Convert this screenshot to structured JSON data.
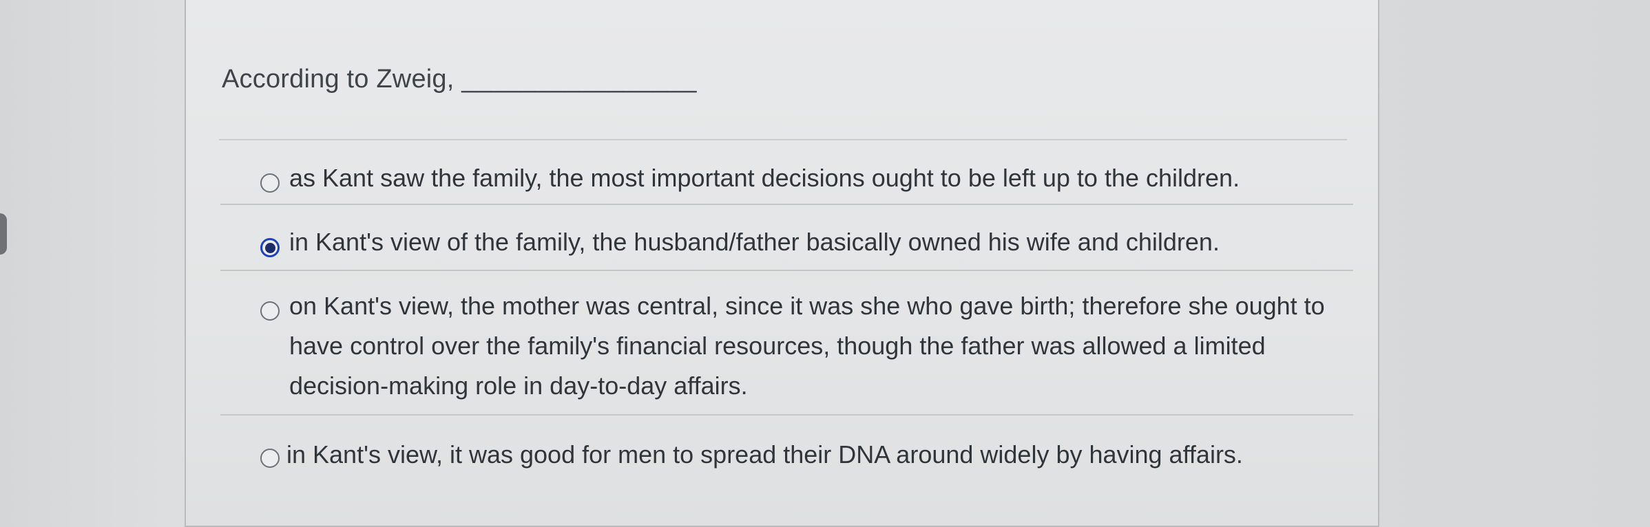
{
  "question": {
    "prompt": "According to Zweig, ________________"
  },
  "options": [
    {
      "text": "as Kant saw the family, the most important decisions ought to be left up to the children.",
      "selected": false
    },
    {
      "text": "in Kant's view of the family, the husband/father basically owned his wife and children.",
      "selected": true
    },
    {
      "text": "on Kant's view, the mother was central, since it was she who gave birth; therefore she ought to have control over the family's financial resources, though the father was allowed a limited decision-making role in day-to-day affairs.",
      "selected": false
    },
    {
      "text": "in Kant's view, it was good for men to spread their DNA around widely by having affairs.",
      "selected": false
    }
  ],
  "colors": {
    "selected_radio": "#1f3fbf",
    "text": "#30353a"
  }
}
